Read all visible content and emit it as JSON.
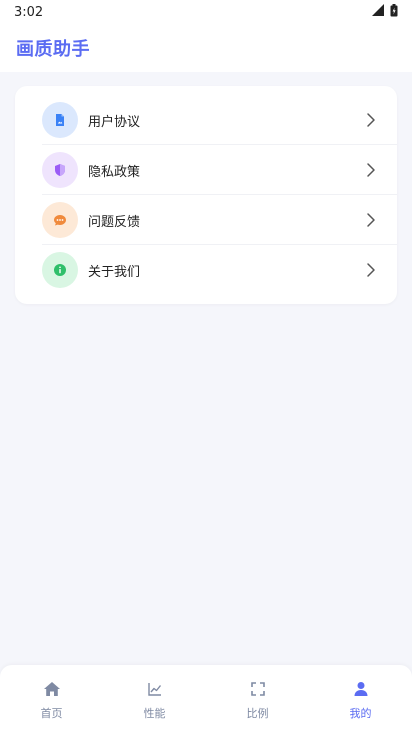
{
  "status_bar": {
    "time": "3:02",
    "icons": [
      "signal-icon",
      "battery-icon"
    ]
  },
  "header": {
    "title": "画质助手",
    "title_color": "#5b6cf2"
  },
  "menu": {
    "items": [
      {
        "label": "用户协议",
        "icon": "document-icon",
        "icon_color": "#3b82f6",
        "bg": "#dbe8fd"
      },
      {
        "label": "隐私政策",
        "icon": "shield-icon",
        "icon_color": "#9b5cf6",
        "bg": "#efe4fd"
      },
      {
        "label": "问题反馈",
        "icon": "chat-bubble-icon",
        "icon_color": "#f08a3c",
        "bg": "#fde9d7"
      },
      {
        "label": "关于我们",
        "icon": "info-icon",
        "icon_color": "#2fbf6a",
        "bg": "#d9f6e3"
      }
    ]
  },
  "bottom_nav": {
    "items": [
      {
        "label": "首页",
        "icon": "home-icon",
        "active": false
      },
      {
        "label": "性能",
        "icon": "chart-line-icon",
        "active": false
      },
      {
        "label": "比例",
        "icon": "fullscreen-icon",
        "active": false
      },
      {
        "label": "我的",
        "icon": "user-icon",
        "active": true
      }
    ],
    "active_color": "#5b6cf2",
    "inactive_color": "#7f8aa3"
  }
}
